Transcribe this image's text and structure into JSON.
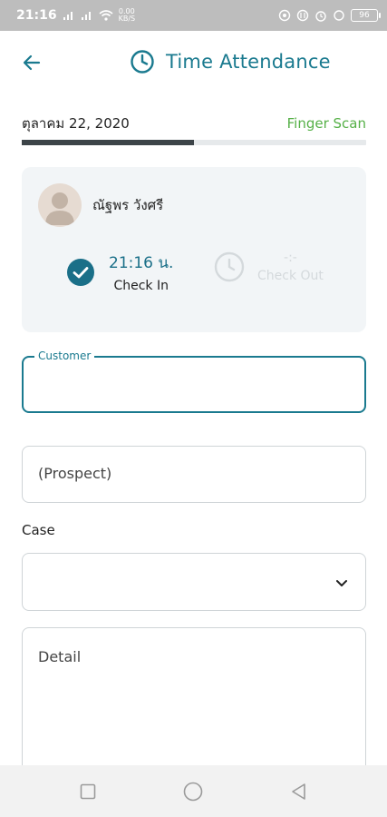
{
  "status_bar": {
    "time": "21:16",
    "signal_1": ".ıl",
    "signal_2": ".ıl",
    "data_rate": "0.00\nKB/S",
    "battery": "96"
  },
  "header": {
    "title": "Time Attendance",
    "back_icon": "arrow-left-icon",
    "title_icon": "clock-icon"
  },
  "date_row": {
    "date": "ตุลาคม 22, 2020",
    "mode": "Finger Scan",
    "progress": 0.5
  },
  "card": {
    "user_name": "ณัฐพร วังศรี",
    "check_in": {
      "time": "21:16 น.",
      "label": "Check In"
    },
    "check_out": {
      "time": "-:-",
      "label": "Check Out"
    }
  },
  "form": {
    "customer": {
      "label": "Customer",
      "value": ""
    },
    "prospect": {
      "placeholder": "(Prospect)"
    },
    "case": {
      "label": "Case",
      "value": ""
    },
    "detail": {
      "placeholder": "Detail"
    }
  },
  "colors": {
    "accent": "#1a7a8f",
    "green": "#55b047",
    "card_bg": "#f2f5f7"
  }
}
